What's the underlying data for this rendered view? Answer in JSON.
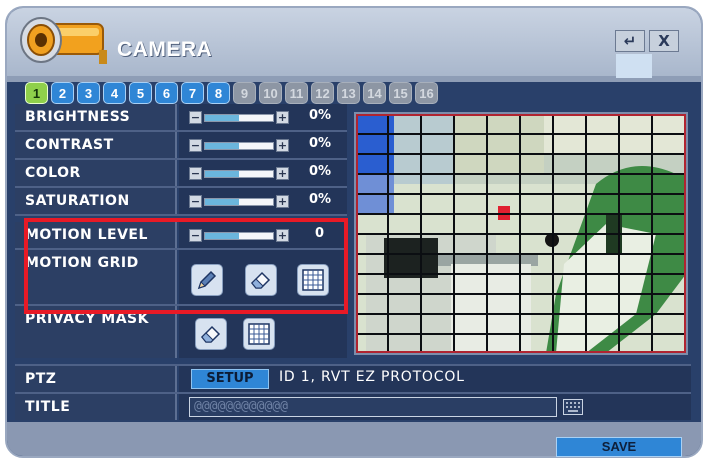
{
  "window": {
    "title": "CAMERA",
    "enter_glyph": "↵",
    "close_glyph": "X"
  },
  "tabs": [
    {
      "label": "1",
      "state": "active"
    },
    {
      "label": "2",
      "state": "on"
    },
    {
      "label": "3",
      "state": "on"
    },
    {
      "label": "4",
      "state": "on"
    },
    {
      "label": "5",
      "state": "on"
    },
    {
      "label": "6",
      "state": "on"
    },
    {
      "label": "7",
      "state": "on"
    },
    {
      "label": "8",
      "state": "on"
    },
    {
      "label": "9",
      "state": "off"
    },
    {
      "label": "10",
      "state": "off"
    },
    {
      "label": "11",
      "state": "off"
    },
    {
      "label": "12",
      "state": "off"
    },
    {
      "label": "13",
      "state": "off"
    },
    {
      "label": "14",
      "state": "off"
    },
    {
      "label": "15",
      "state": "off"
    },
    {
      "label": "16",
      "state": "off"
    }
  ],
  "settings": {
    "brightness": {
      "label": "BRIGHTNESS",
      "value": "0%",
      "level": 0.5
    },
    "contrast": {
      "label": "CONTRAST",
      "value": "0%",
      "level": 0.5
    },
    "color": {
      "label": "COLOR",
      "value": "0%",
      "level": 0.5
    },
    "saturation": {
      "label": "SATURATION",
      "value": "0%",
      "level": 0.5
    },
    "motion_level": {
      "label": "MOTION LEVEL",
      "value": "0",
      "level": 0.5
    },
    "motion_grid": {
      "label": "MOTION GRID"
    },
    "privacy_mask": {
      "label": "PRIVACY MASK"
    }
  },
  "slider_glyphs": {
    "minus": "−",
    "plus": "+"
  },
  "ptz": {
    "label": "PTZ",
    "setup_label": "SETUP",
    "info": "ID 1, RVT EZ PROTOCOL"
  },
  "title_field": {
    "label": "TITLE",
    "value": "@@@@@@@@@@@@"
  },
  "save_label": "SAVE",
  "colors": {
    "accent": "#2f86d6",
    "highlight": "#e81a26",
    "active_tab": "#8fd04b",
    "panel": "#29406a"
  }
}
